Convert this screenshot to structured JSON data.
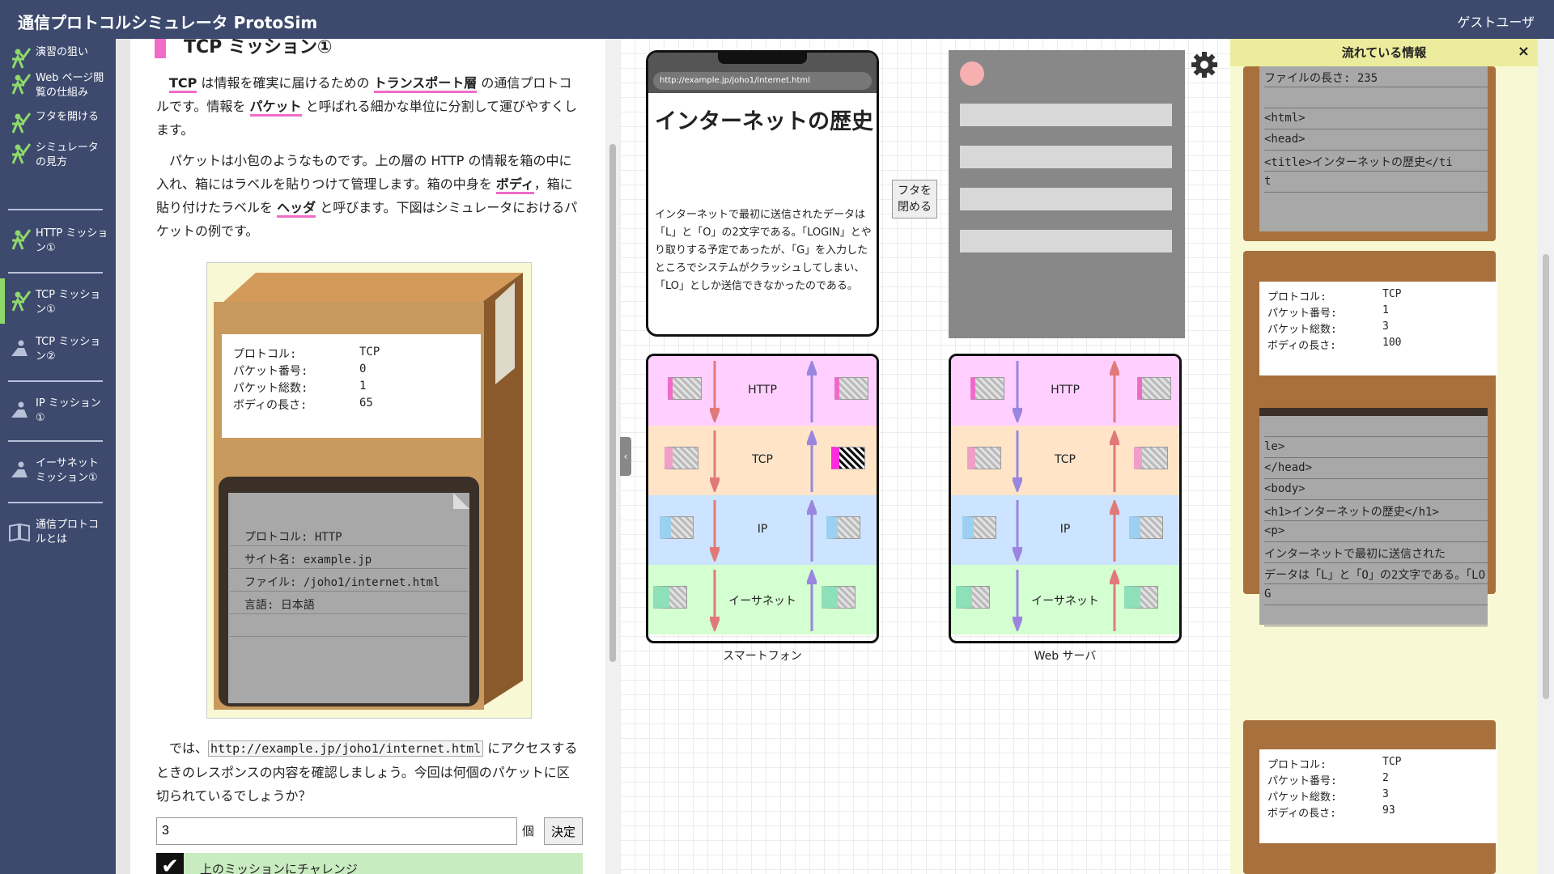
{
  "app": {
    "title": "通信プロトコルシミュレータ ProtoSim",
    "user": "ゲストユーザ"
  },
  "sidebar": {
    "items": [
      {
        "label": "演習の狙い",
        "icon": "check-person-icon"
      },
      {
        "label": "Web ページ閲覧の仕組み",
        "icon": "check-person-icon"
      },
      {
        "label": "フタを開ける",
        "icon": "check-person-icon"
      },
      {
        "label": "シミュレータの見方",
        "icon": "check-person-icon"
      },
      {
        "label": "HTTP ミッション①",
        "icon": "check-person-icon"
      },
      {
        "label": "TCP ミッション①",
        "icon": "check-person-icon",
        "active": true
      },
      {
        "label": "TCP ミッション②",
        "icon": "person-icon"
      },
      {
        "label": "IP ミッション①",
        "icon": "person-icon"
      },
      {
        "label": "イーサネットミッション①",
        "icon": "person-icon"
      },
      {
        "label": "通信プロトコルとは",
        "icon": "book-icon"
      }
    ]
  },
  "mission": {
    "title": "TCP ミッション①",
    "p1": {
      "t1": "TCP",
      "t2": " は情報を確実に届けるための ",
      "t3": "トランスポート層",
      "t4": " の通信プロトコルです。情報を ",
      "t5": "パケット",
      "t6": " と呼ばれる細かな単位に分割して運びやすくします。"
    },
    "p2": {
      "t1": "パケットは小包のようなものです。上の層の HTTP の情報を箱の中に入れ、箱にはラベルを貼りつけて管理します。箱の中身を ",
      "t2": "ボディ",
      "t3": "，箱に貼り付けたラベルを ",
      "t4": "ヘッダ",
      "t5": " と呼びます。下図はシミュレータにおけるパケットの例です。"
    },
    "figure": {
      "label": [
        {
          "k": "プロトコル:",
          "v": "TCP"
        },
        {
          "k": "パケット番号:",
          "v": "0"
        },
        {
          "k": "パケット総数:",
          "v": "1"
        },
        {
          "k": "ボディの長さ:",
          "v": "65"
        }
      ],
      "doc": [
        "プロトコル: HTTP",
        "サイト名: example.jp",
        "ファイル: /joho1/internet.html",
        "言語: 日本語",
        ""
      ]
    },
    "p3": {
      "t1": "では、",
      "url": "http://example.jp/joho1/internet.html",
      "t2": " にアクセスするときのレスポンスの内容を確認しましょう。今回は何個のパケットに区切られているでしょうか？"
    },
    "answer_value": "3",
    "unit": "個",
    "submit": "決定",
    "challenge": "上のミッションにチャレンジ",
    "check": "✔"
  },
  "phone": {
    "url": "http://example.jp/joho1/internet.html",
    "heading": "インターネットの歴史",
    "body": "インターネットで最初に送信されたデータは「L」と「O」の2文字である。「LOGIN」とやり取りする予定であったが、「G」を入力したところでシステムがクラッシュしてしまい、「LO」としか送信できなかったのである。"
  },
  "lid_button": "フタを閉める",
  "stacks": [
    {
      "caption": "スマートフォン",
      "layers": [
        "HTTP",
        "TCP",
        "IP",
        "イーサネット"
      ]
    },
    {
      "caption": "Web サーバ",
      "layers": [
        "HTTP",
        "TCP",
        "IP",
        "イーサネット"
      ]
    }
  ],
  "info": {
    "title": "流れている情報",
    "close": "×",
    "box1": [
      "ファイルの長さ: 235",
      "",
      "<html>",
      "  <head>",
      "    <title>インターネットの歴史</ti",
      "t"
    ],
    "box2_label": [
      {
        "k": "プロトコル:",
        "v": "TCP"
      },
      {
        "k": "パケット番号:",
        "v": "1"
      },
      {
        "k": "パケット総数:",
        "v": "3"
      },
      {
        "k": "ボディの長さ:",
        "v": "100"
      }
    ],
    "box3": [
      "",
      "le>",
      "  </head>",
      "  <body>",
      "    <h1>インターネットの歴史</h1>",
      "    <p>",
      "      インターネットで最初に送信された",
      "データは「L」と「O」の2文字である。「LO",
      "G",
      ""
    ],
    "box4_label": [
      {
        "k": "プロトコル:",
        "v": "TCP"
      },
      {
        "k": "パケット番号:",
        "v": "2"
      },
      {
        "k": "パケット総数:",
        "v": "3"
      },
      {
        "k": "ボディの長さ:",
        "v": "93"
      }
    ]
  },
  "colors": {
    "navy": "#3d4a6e",
    "pink": "#f06bc8",
    "box": "#a8703c",
    "http": "#ffd0ff",
    "tcp": "#ffe4c8",
    "ip": "#cce4ff",
    "eth": "#d4ffd0"
  }
}
